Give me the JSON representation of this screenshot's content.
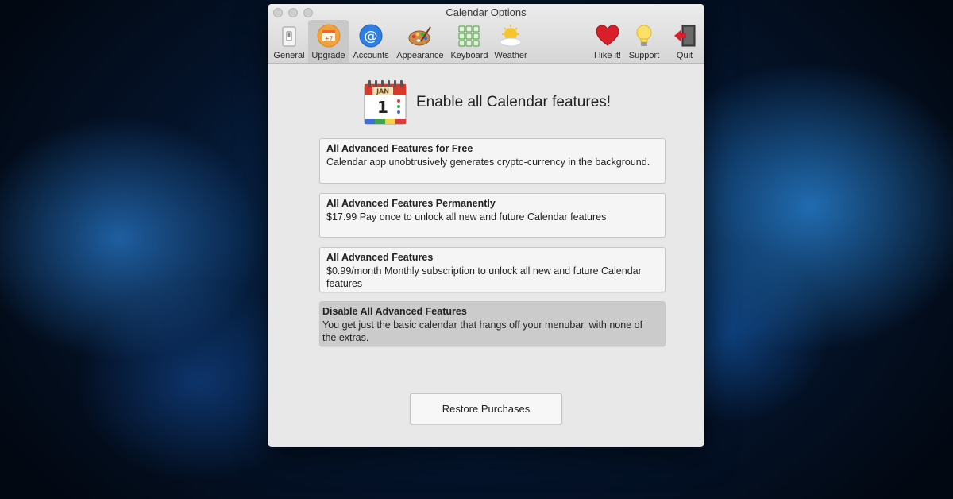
{
  "window": {
    "title": "Calendar Options"
  },
  "toolbar": {
    "tabs": [
      {
        "label": "General",
        "icon": "switch-icon"
      },
      {
        "label": "Upgrade",
        "icon": "calendar-plus-icon",
        "badge": "+7"
      },
      {
        "label": "Accounts",
        "icon": "at-sign-icon"
      },
      {
        "label": "Appearance",
        "icon": "palette-icon"
      },
      {
        "label": "Keyboard",
        "icon": "keyboard-icon"
      },
      {
        "label": "Weather",
        "icon": "sun-cloud-icon"
      },
      {
        "label": "I like it!",
        "icon": "heart-icon"
      },
      {
        "label": "Support",
        "icon": "lightbulb-icon"
      },
      {
        "label": "Quit",
        "icon": "exit-door-icon"
      }
    ],
    "active_tab": "Upgrade"
  },
  "upgrade": {
    "heading": "Enable all Calendar features!",
    "calendar_icon": {
      "month": "JAN",
      "day": "1"
    },
    "options": [
      {
        "title": "All Advanced Features for Free",
        "description": "Calendar app unobtrusively generates crypto-currency in the background."
      },
      {
        "title": "All Advanced Features Permanently",
        "description": "$17.99 Pay once to unlock all new and future Calendar features"
      },
      {
        "title": "All Advanced Features",
        "description": "$0.99/month Monthly subscription to unlock all new and future Calendar features"
      },
      {
        "title": "Disable All Advanced Features",
        "description": "You get just the basic calendar that hangs off your menubar, with none of the extras.",
        "selected": true
      }
    ],
    "restore_button": "Restore Purchases"
  },
  "colors": {
    "window_bg": "#e8e8e8",
    "selected_option_bg": "#cbcbcb",
    "heart_red": "#d9202a",
    "accounts_blue": "#2f7fe0",
    "upgrade_orange": "#f2a23a"
  }
}
